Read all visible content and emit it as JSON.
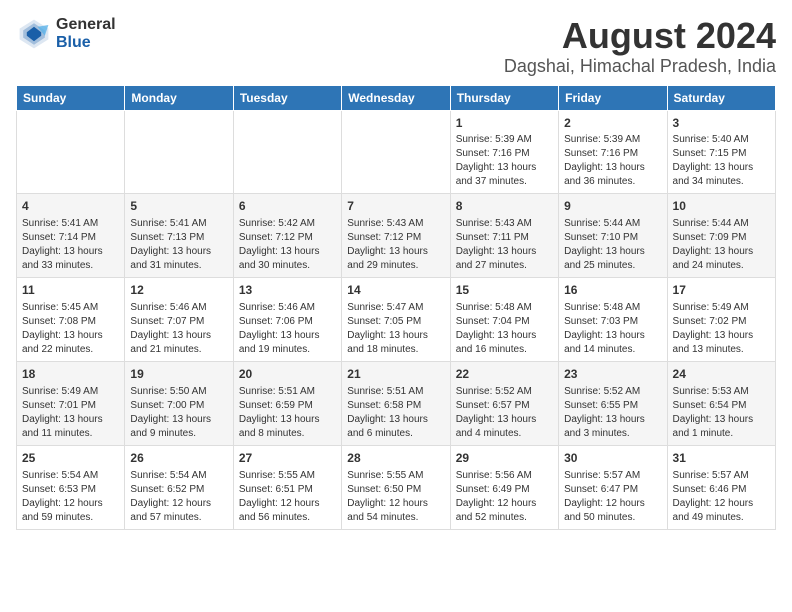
{
  "header": {
    "logo_line1": "General",
    "logo_line2": "Blue",
    "title": "August 2024",
    "subtitle": "Dagshai, Himachal Pradesh, India"
  },
  "calendar": {
    "days_of_week": [
      "Sunday",
      "Monday",
      "Tuesday",
      "Wednesday",
      "Thursday",
      "Friday",
      "Saturday"
    ],
    "weeks": [
      [
        {
          "day": "",
          "info": ""
        },
        {
          "day": "",
          "info": ""
        },
        {
          "day": "",
          "info": ""
        },
        {
          "day": "",
          "info": ""
        },
        {
          "day": "1",
          "info": "Sunrise: 5:39 AM\nSunset: 7:16 PM\nDaylight: 13 hours and 37 minutes."
        },
        {
          "day": "2",
          "info": "Sunrise: 5:39 AM\nSunset: 7:16 PM\nDaylight: 13 hours and 36 minutes."
        },
        {
          "day": "3",
          "info": "Sunrise: 5:40 AM\nSunset: 7:15 PM\nDaylight: 13 hours and 34 minutes."
        }
      ],
      [
        {
          "day": "4",
          "info": "Sunrise: 5:41 AM\nSunset: 7:14 PM\nDaylight: 13 hours and 33 minutes."
        },
        {
          "day": "5",
          "info": "Sunrise: 5:41 AM\nSunset: 7:13 PM\nDaylight: 13 hours and 31 minutes."
        },
        {
          "day": "6",
          "info": "Sunrise: 5:42 AM\nSunset: 7:12 PM\nDaylight: 13 hours and 30 minutes."
        },
        {
          "day": "7",
          "info": "Sunrise: 5:43 AM\nSunset: 7:12 PM\nDaylight: 13 hours and 29 minutes."
        },
        {
          "day": "8",
          "info": "Sunrise: 5:43 AM\nSunset: 7:11 PM\nDaylight: 13 hours and 27 minutes."
        },
        {
          "day": "9",
          "info": "Sunrise: 5:44 AM\nSunset: 7:10 PM\nDaylight: 13 hours and 25 minutes."
        },
        {
          "day": "10",
          "info": "Sunrise: 5:44 AM\nSunset: 7:09 PM\nDaylight: 13 hours and 24 minutes."
        }
      ],
      [
        {
          "day": "11",
          "info": "Sunrise: 5:45 AM\nSunset: 7:08 PM\nDaylight: 13 hours and 22 minutes."
        },
        {
          "day": "12",
          "info": "Sunrise: 5:46 AM\nSunset: 7:07 PM\nDaylight: 13 hours and 21 minutes."
        },
        {
          "day": "13",
          "info": "Sunrise: 5:46 AM\nSunset: 7:06 PM\nDaylight: 13 hours and 19 minutes."
        },
        {
          "day": "14",
          "info": "Sunrise: 5:47 AM\nSunset: 7:05 PM\nDaylight: 13 hours and 18 minutes."
        },
        {
          "day": "15",
          "info": "Sunrise: 5:48 AM\nSunset: 7:04 PM\nDaylight: 13 hours and 16 minutes."
        },
        {
          "day": "16",
          "info": "Sunrise: 5:48 AM\nSunset: 7:03 PM\nDaylight: 13 hours and 14 minutes."
        },
        {
          "day": "17",
          "info": "Sunrise: 5:49 AM\nSunset: 7:02 PM\nDaylight: 13 hours and 13 minutes."
        }
      ],
      [
        {
          "day": "18",
          "info": "Sunrise: 5:49 AM\nSunset: 7:01 PM\nDaylight: 13 hours and 11 minutes."
        },
        {
          "day": "19",
          "info": "Sunrise: 5:50 AM\nSunset: 7:00 PM\nDaylight: 13 hours and 9 minutes."
        },
        {
          "day": "20",
          "info": "Sunrise: 5:51 AM\nSunset: 6:59 PM\nDaylight: 13 hours and 8 minutes."
        },
        {
          "day": "21",
          "info": "Sunrise: 5:51 AM\nSunset: 6:58 PM\nDaylight: 13 hours and 6 minutes."
        },
        {
          "day": "22",
          "info": "Sunrise: 5:52 AM\nSunset: 6:57 PM\nDaylight: 13 hours and 4 minutes."
        },
        {
          "day": "23",
          "info": "Sunrise: 5:52 AM\nSunset: 6:55 PM\nDaylight: 13 hours and 3 minutes."
        },
        {
          "day": "24",
          "info": "Sunrise: 5:53 AM\nSunset: 6:54 PM\nDaylight: 13 hours and 1 minute."
        }
      ],
      [
        {
          "day": "25",
          "info": "Sunrise: 5:54 AM\nSunset: 6:53 PM\nDaylight: 12 hours and 59 minutes."
        },
        {
          "day": "26",
          "info": "Sunrise: 5:54 AM\nSunset: 6:52 PM\nDaylight: 12 hours and 57 minutes."
        },
        {
          "day": "27",
          "info": "Sunrise: 5:55 AM\nSunset: 6:51 PM\nDaylight: 12 hours and 56 minutes."
        },
        {
          "day": "28",
          "info": "Sunrise: 5:55 AM\nSunset: 6:50 PM\nDaylight: 12 hours and 54 minutes."
        },
        {
          "day": "29",
          "info": "Sunrise: 5:56 AM\nSunset: 6:49 PM\nDaylight: 12 hours and 52 minutes."
        },
        {
          "day": "30",
          "info": "Sunrise: 5:57 AM\nSunset: 6:47 PM\nDaylight: 12 hours and 50 minutes."
        },
        {
          "day": "31",
          "info": "Sunrise: 5:57 AM\nSunset: 6:46 PM\nDaylight: 12 hours and 49 minutes."
        }
      ]
    ]
  }
}
